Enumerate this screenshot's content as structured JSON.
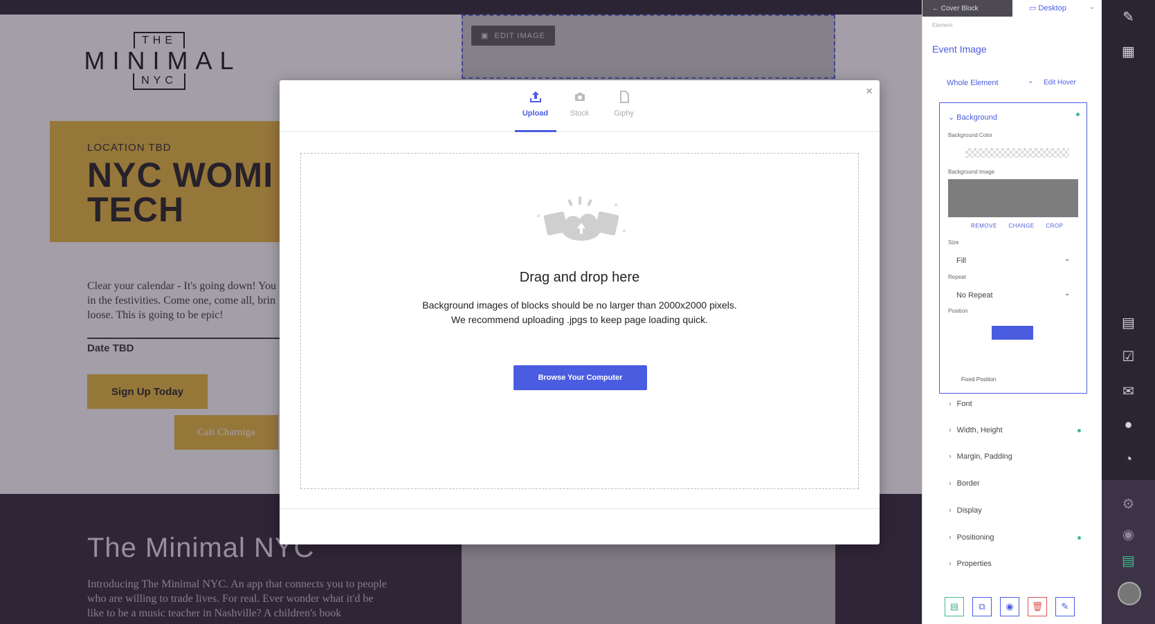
{
  "page": {
    "logo": {
      "the": "THE",
      "minimal": "MINIMAL",
      "nyc": "NYC"
    },
    "hero": {
      "location": "LOCATION TBD",
      "title": "NYC WOMI\nTECH"
    },
    "description": "Clear your calendar - It's going down! You\nin the festivities. Come one, come all, brin\nloose. This is going to be epic!",
    "date": "Date TBD",
    "signup_label": "Sign Up Today",
    "speaker": "Cait Charniga",
    "event_image_tag": "EDIT IMAGE",
    "section2": {
      "heading": "The Minimal NYC",
      "body": "Introducing The Minimal NYC. An app that connects you to people who are willing to trade lives. For real. Ever wonder what it'd be like to be a music teacher in Nashville? A children's book"
    }
  },
  "modal": {
    "close": "×",
    "tabs": [
      {
        "label": "Upload",
        "icon": "upload-icon",
        "active": true
      },
      {
        "label": "Stock",
        "icon": "camera-icon",
        "active": false
      },
      {
        "label": "Giphy",
        "icon": "file-icon",
        "active": false
      }
    ],
    "drop_title": "Drag and drop here",
    "drop_line1": "Background images of blocks should be no larger than 2000x2000 pixels.",
    "drop_line2": "We recommend uploading .jpgs to keep page loading quick.",
    "browse_label": "Browse Your Computer"
  },
  "panel": {
    "breadcrumb": "← Cover Block",
    "device": "Desktop",
    "element_label": "Element",
    "element_name": "Event Image",
    "scope": "Whole Element",
    "edit_hover": "Edit Hover",
    "background": {
      "title": "Background",
      "color_label": "Background Color",
      "image_label": "Background Image",
      "actions": [
        "REMOVE",
        "CHANGE",
        "CROP"
      ],
      "size_label": "Size",
      "size_value": "Fill",
      "repeat_label": "Repeat",
      "repeat_value": "No Repeat",
      "position_label": "Position",
      "fixed_label": "Fixed Position"
    },
    "sections": [
      "Font",
      "Width, Height",
      "Margin, Padding",
      "Border",
      "Display",
      "Positioning",
      "Properties"
    ],
    "accent_color": "#4a5ce0"
  },
  "rail": {
    "icons": [
      "pencil-icon",
      "layout-icon",
      "page-icon",
      "checklist-icon",
      "mail-icon",
      "user-icon",
      "pie-chart-icon",
      "gear-icon",
      "eye-icon",
      "save-icon"
    ]
  }
}
